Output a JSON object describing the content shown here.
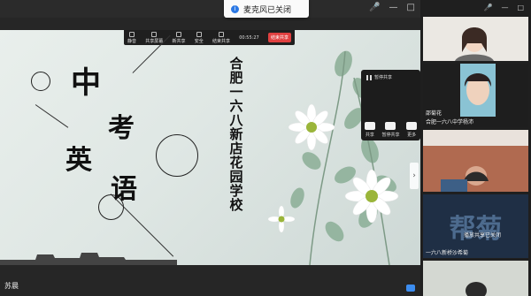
{
  "toast": {
    "text": "麦克风已关闭",
    "icon": "info-icon"
  },
  "window_controls": {
    "icons": [
      "mic-icon",
      "minimize-icon",
      "close-icon"
    ]
  },
  "share_bar": {
    "items": [
      "静音",
      "共享屏幕",
      "新共享",
      "安全",
      "结束共享"
    ],
    "timer": "00:55:27",
    "stop_label": "结束共享"
  },
  "slide": {
    "chars": [
      "中",
      "考",
      "英",
      "语"
    ],
    "school": "合肥一六八新店花园学校"
  },
  "popup": {
    "title": "暂停共享",
    "buttons": [
      "共享",
      "暂停共享",
      "更多"
    ]
  },
  "presenter": {
    "name": "苏晨"
  },
  "participants": [
    {
      "name": ""
    },
    {
      "name": "合肥一六八中学杨沛",
      "label": "邵菊花"
    },
    {
      "name": "一六八新桥沙希菊",
      "label": "播放共享已关闭"
    },
    {
      "name": "帮菊",
      "label": ""
    }
  ],
  "participant_labels": {
    "p2": "邵菊花",
    "p2sub": "合肥一六八中学杨沛",
    "p4big": "帮菊",
    "p4sub": "播放共享已关闭",
    "p4name": "一六八新桥沙希菊"
  }
}
